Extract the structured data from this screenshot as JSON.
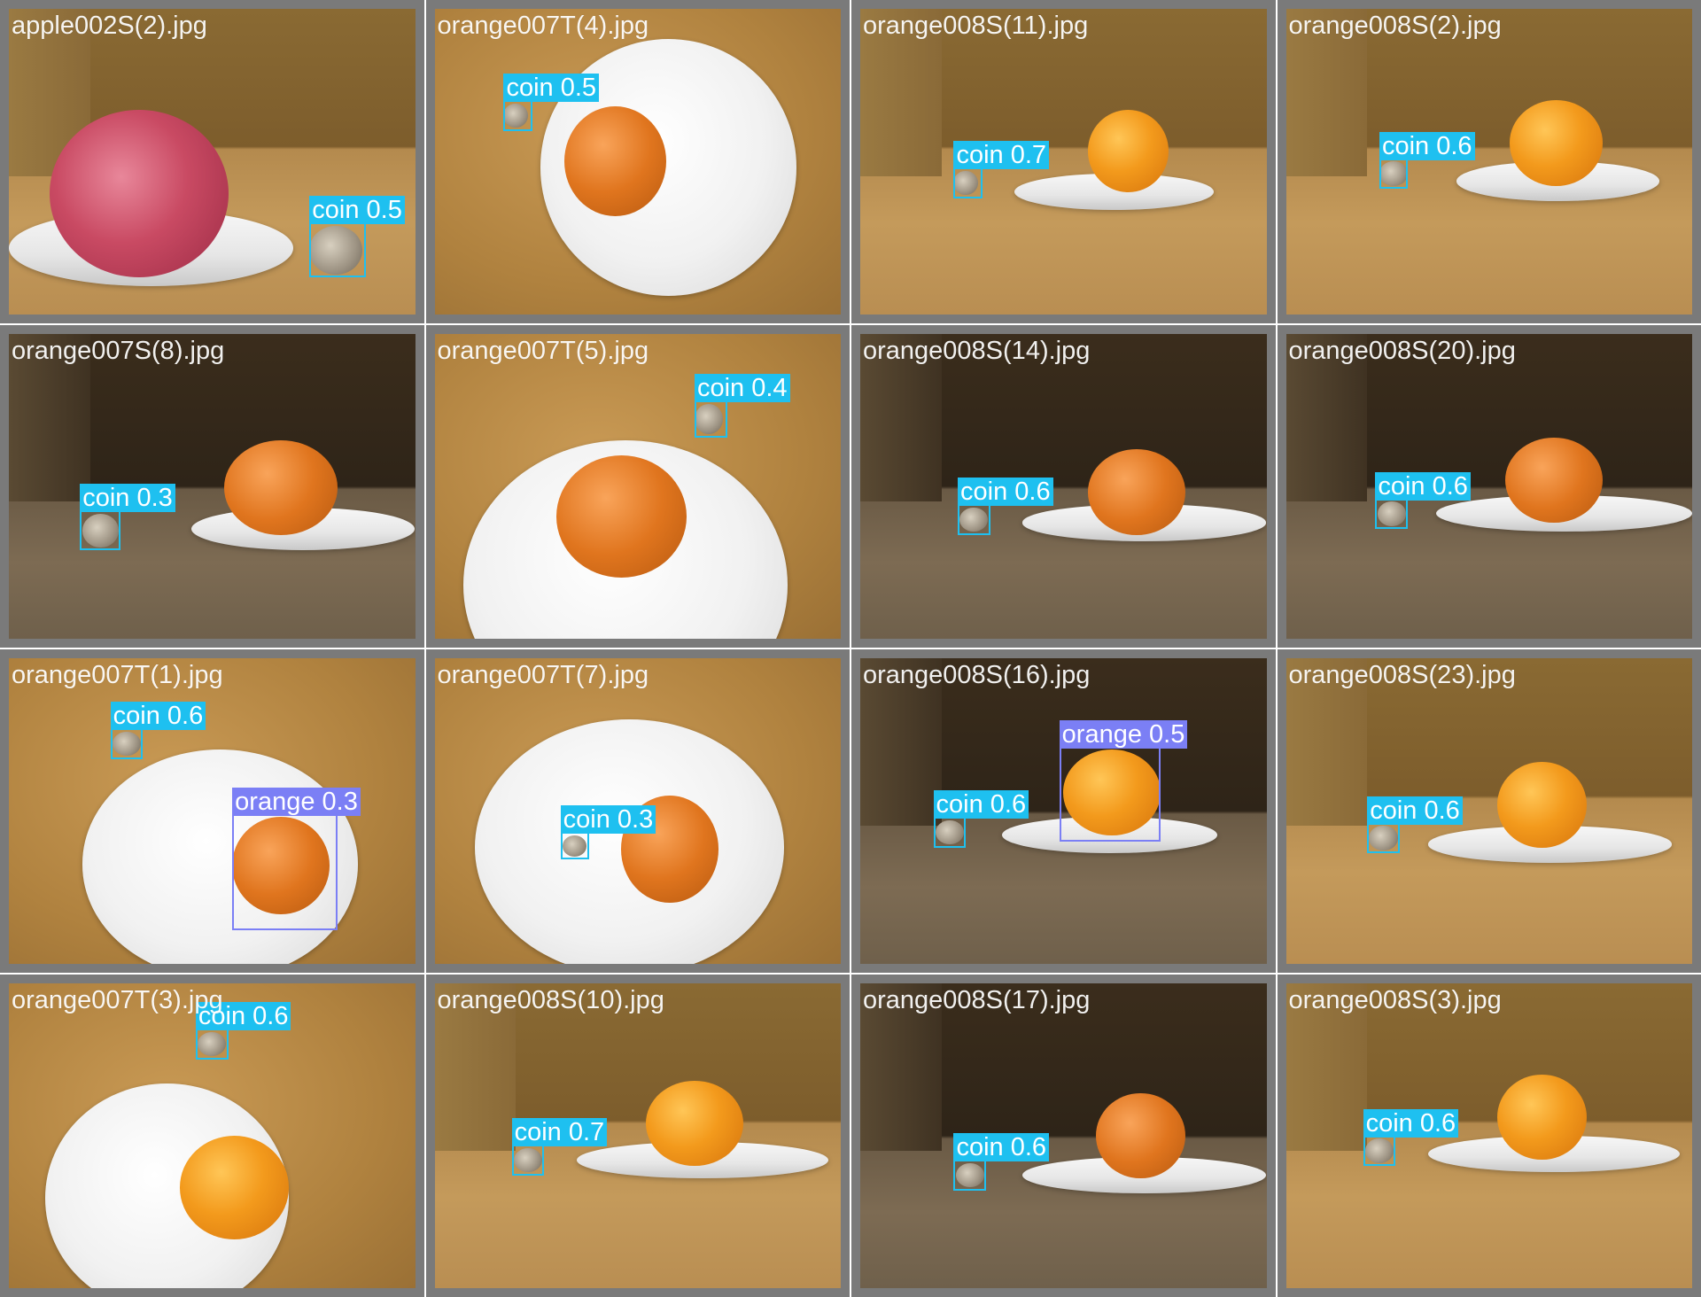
{
  "tiles": [
    {
      "filename": "apple002S(2).jpg",
      "scene": "side",
      "detections": [
        {
          "label": "coin 0.5",
          "class": "coin",
          "confidence": 0.5
        }
      ]
    },
    {
      "filename": "orange007T(4).jpg",
      "scene": "top",
      "detections": [
        {
          "label": "coin 0.5",
          "class": "coin",
          "confidence": 0.5
        }
      ]
    },
    {
      "filename": "orange008S(11).jpg",
      "scene": "side",
      "detections": [
        {
          "label": "coin 0.7",
          "class": "coin",
          "confidence": 0.7
        }
      ]
    },
    {
      "filename": "orange008S(2).jpg",
      "scene": "side",
      "detections": [
        {
          "label": "coin 0.6",
          "class": "coin",
          "confidence": 0.6
        }
      ]
    },
    {
      "filename": "orange007S(8).jpg",
      "scene": "side-dark",
      "detections": [
        {
          "label": "coin 0.3",
          "class": "coin",
          "confidence": 0.3
        }
      ]
    },
    {
      "filename": "orange007T(5).jpg",
      "scene": "top",
      "detections": [
        {
          "label": "coin 0.4",
          "class": "coin",
          "confidence": 0.4
        }
      ]
    },
    {
      "filename": "orange008S(14).jpg",
      "scene": "side-dark",
      "detections": [
        {
          "label": "coin 0.6",
          "class": "coin",
          "confidence": 0.6
        }
      ]
    },
    {
      "filename": "orange008S(20).jpg",
      "scene": "side-dark",
      "detections": [
        {
          "label": "coin 0.6",
          "class": "coin",
          "confidence": 0.6
        }
      ]
    },
    {
      "filename": "orange007T(1).jpg",
      "scene": "top",
      "detections": [
        {
          "label": "coin 0.6",
          "class": "coin",
          "confidence": 0.6
        },
        {
          "label": "orange 0.3",
          "class": "orange",
          "confidence": 0.3
        }
      ]
    },
    {
      "filename": "orange007T(7).jpg",
      "scene": "top",
      "detections": [
        {
          "label": "coin 0.3",
          "class": "coin",
          "confidence": 0.3
        }
      ]
    },
    {
      "filename": "orange008S(16).jpg",
      "scene": "side-dark",
      "detections": [
        {
          "label": "orange 0.5",
          "class": "orange",
          "confidence": 0.5
        },
        {
          "label": "coin 0.6",
          "class": "coin",
          "confidence": 0.6
        }
      ]
    },
    {
      "filename": "orange008S(23).jpg",
      "scene": "side",
      "detections": [
        {
          "label": "coin 0.6",
          "class": "coin",
          "confidence": 0.6
        }
      ]
    },
    {
      "filename": "orange007T(3).jpg",
      "scene": "top",
      "detections": [
        {
          "label": "coin 0.6",
          "class": "coin",
          "confidence": 0.6
        }
      ]
    },
    {
      "filename": "orange008S(10).jpg",
      "scene": "side",
      "detections": [
        {
          "label": "coin 0.7",
          "class": "coin",
          "confidence": 0.7
        }
      ]
    },
    {
      "filename": "orange008S(17).jpg",
      "scene": "side-dark",
      "detections": [
        {
          "label": "coin 0.6",
          "class": "coin",
          "confidence": 0.6
        }
      ]
    },
    {
      "filename": "orange008S(3).jpg",
      "scene": "side",
      "detections": [
        {
          "label": "coin 0.6",
          "class": "coin",
          "confidence": 0.6
        }
      ]
    }
  ],
  "colors": {
    "coin_box": "#1ec0f0",
    "orange_box": "#7b7ff5",
    "tile_border": "#7a7a7a"
  }
}
